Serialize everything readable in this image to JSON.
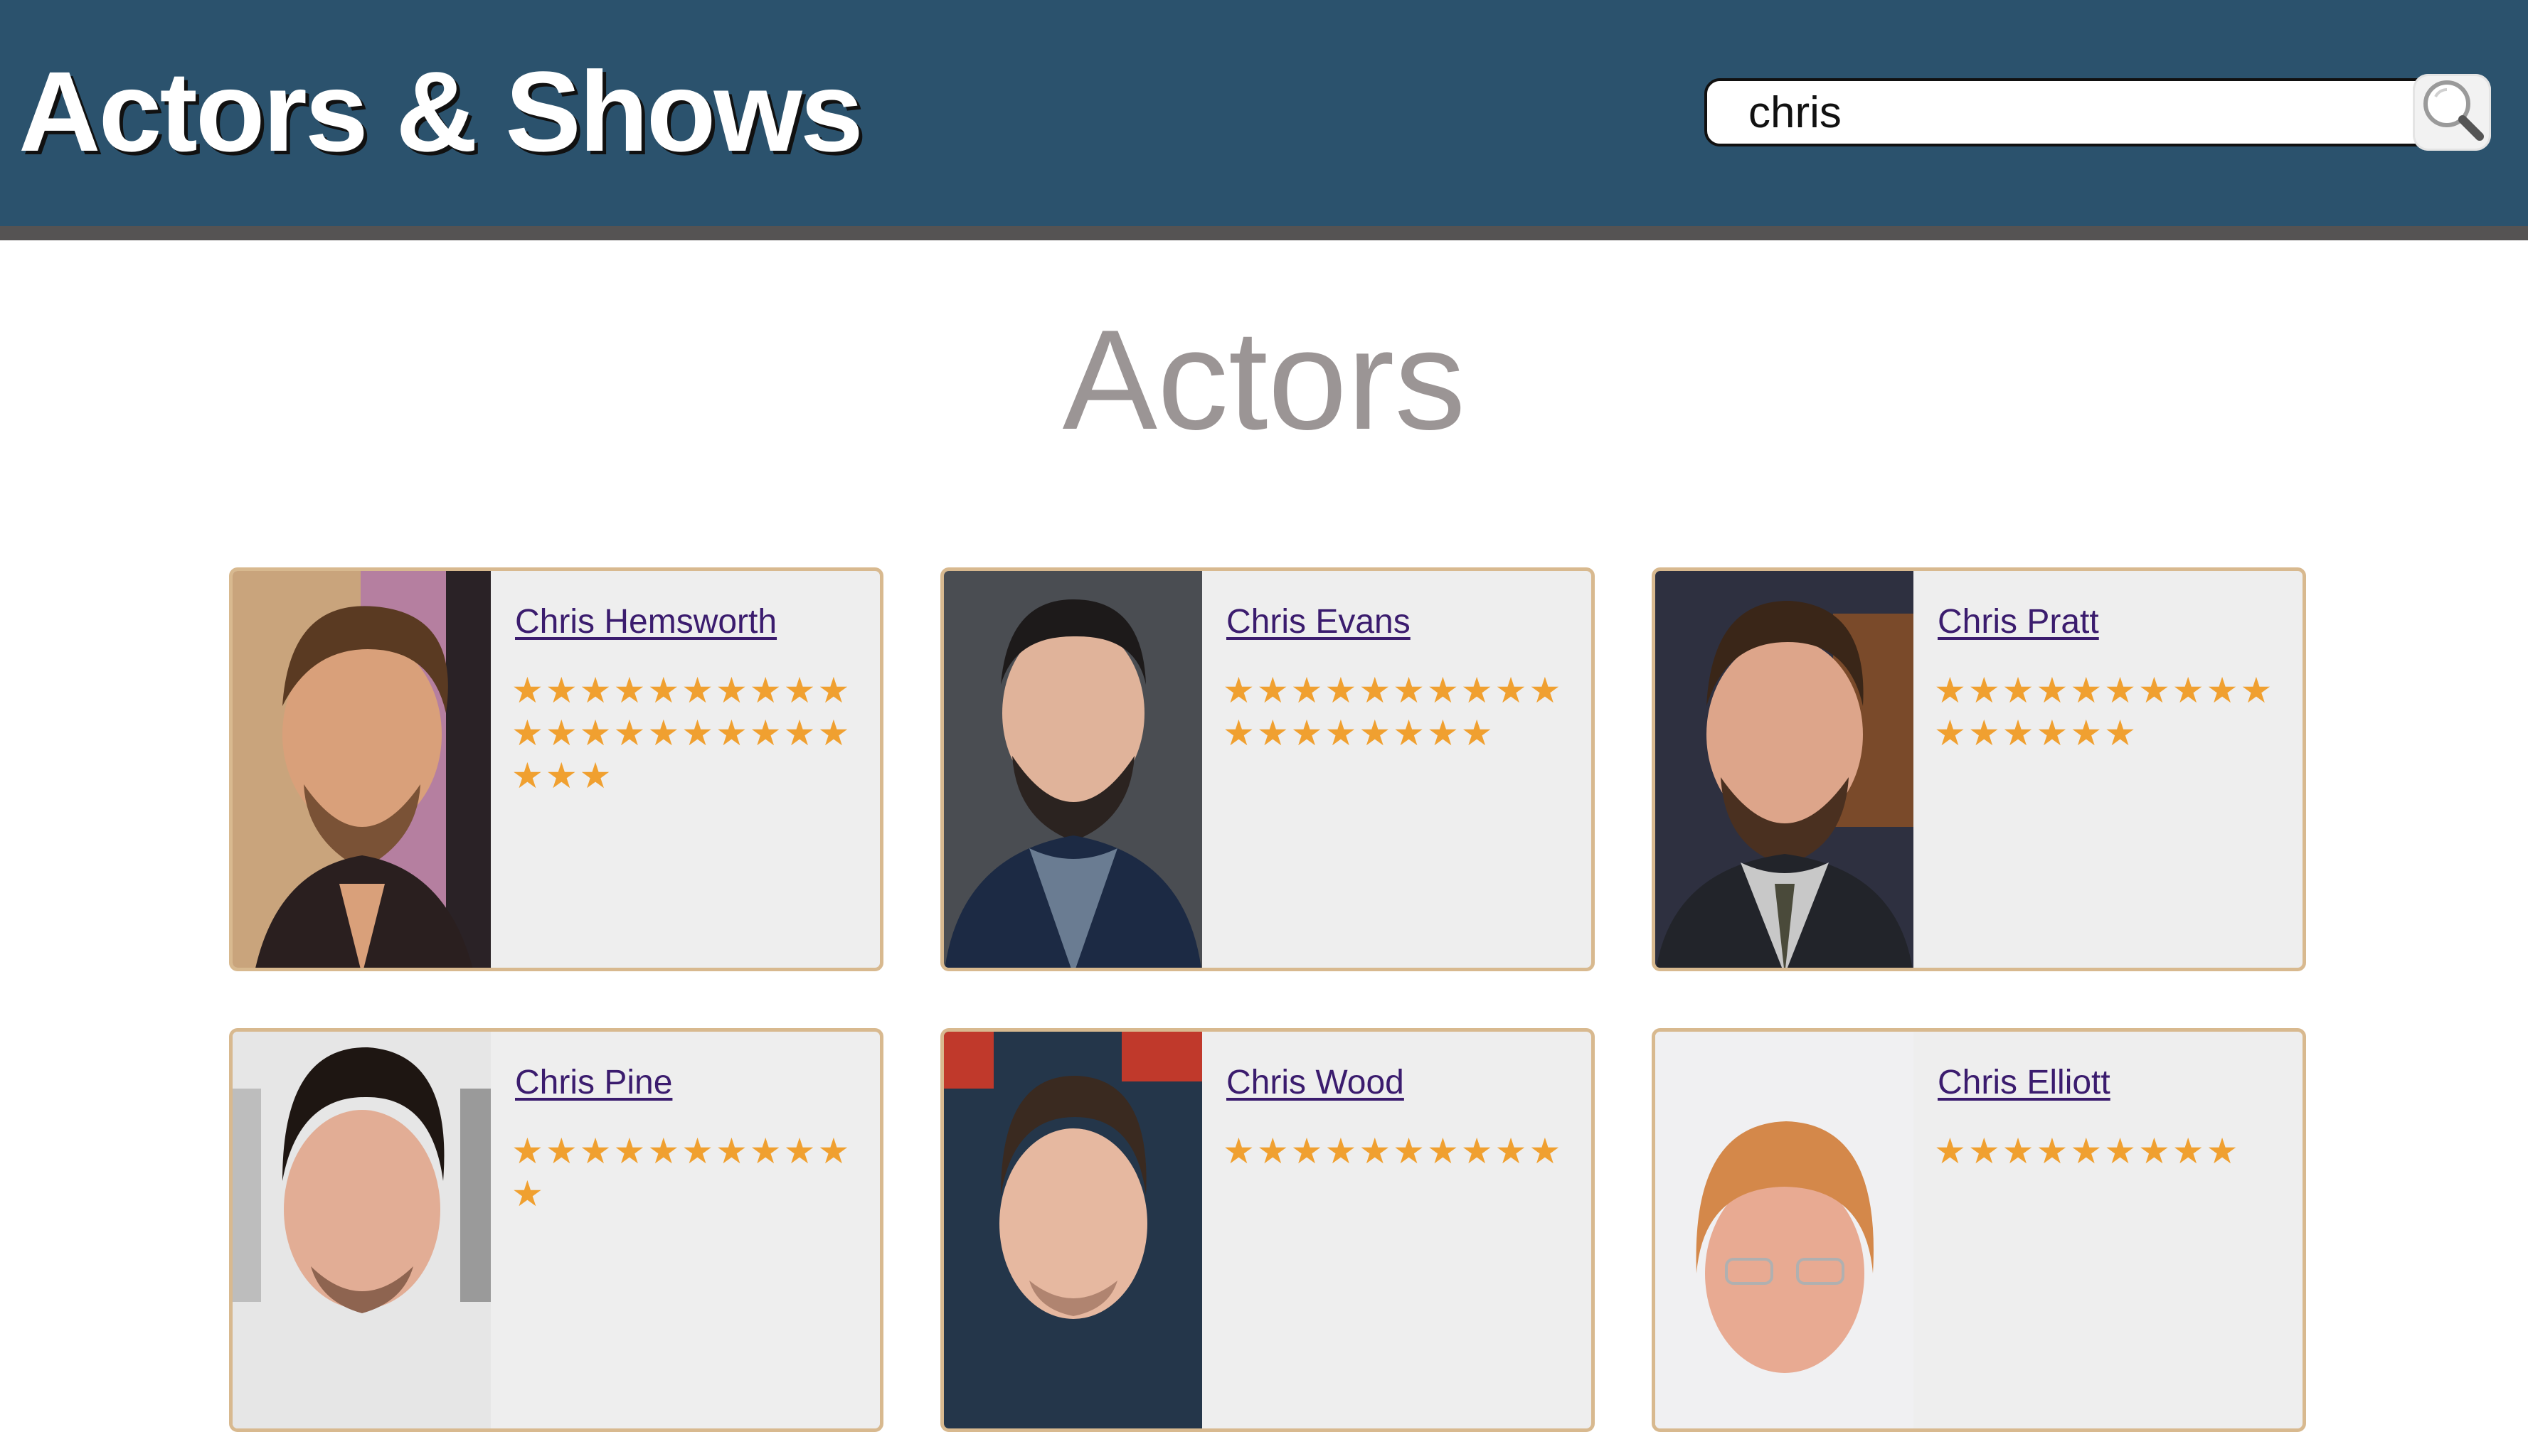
{
  "header": {
    "title": "Actors & Shows",
    "search": {
      "value": "chris",
      "placeholder": "",
      "button_icon": "search-icon"
    },
    "colors": {
      "background": "#2b526d",
      "bar": "#555353"
    }
  },
  "main": {
    "section_title": "Actors",
    "actors": [
      {
        "name": "Chris Hemsworth",
        "rating": 23,
        "photo_icon": "actor-photo"
      },
      {
        "name": "Chris Evans",
        "rating": 18,
        "photo_icon": "actor-photo"
      },
      {
        "name": "Chris Pratt",
        "rating": 16,
        "photo_icon": "actor-photo"
      },
      {
        "name": "Chris Pine",
        "rating": 11,
        "photo_icon": "actor-photo"
      },
      {
        "name": "Chris Wood",
        "rating": 10,
        "photo_icon": "actor-photo"
      },
      {
        "name": "Chris Elliott",
        "rating": 9,
        "photo_icon": "actor-photo"
      }
    ],
    "colors": {
      "card_border": "#d8b98f",
      "card_background": "#eeeeee",
      "star": "#f0a030",
      "link": "#3b1c6e",
      "section_title": "#9b9595"
    }
  }
}
